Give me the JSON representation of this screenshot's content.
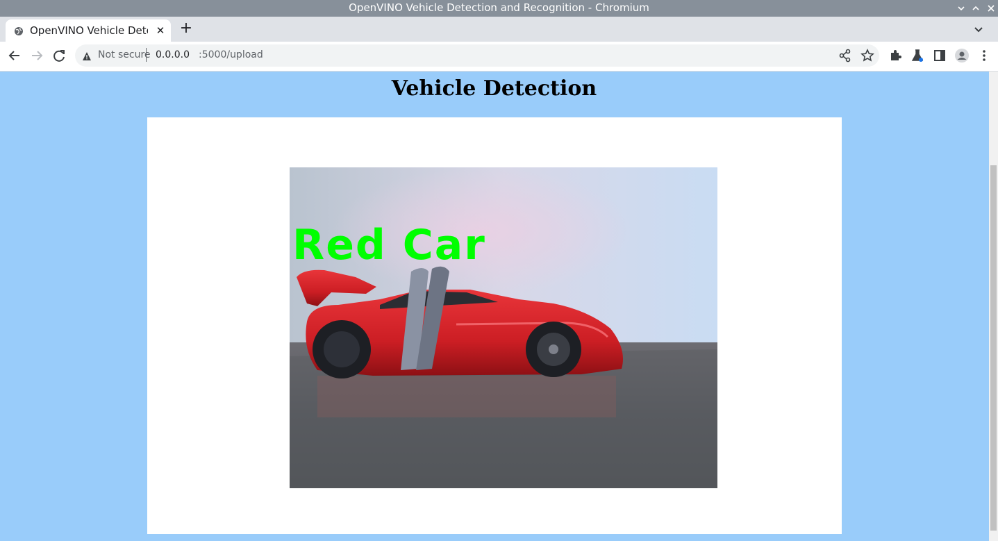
{
  "window": {
    "title": "OpenVINO Vehicle Detection and Recognition - Chromium"
  },
  "tab": {
    "label": "OpenVINO Vehicle Detec",
    "close_label": "✕"
  },
  "new_tab_label": "+",
  "omnibox": {
    "security_text": "Not secure",
    "host": "0.0.0.0",
    "path": ":5000/upload"
  },
  "page": {
    "heading": "Vehicle Detection"
  },
  "result_image": {
    "overlay_label": "Red Car"
  },
  "colors": {
    "page_bg": "#99ccfa",
    "overlay_text": "#00ff00",
    "car": "#d21f23"
  }
}
